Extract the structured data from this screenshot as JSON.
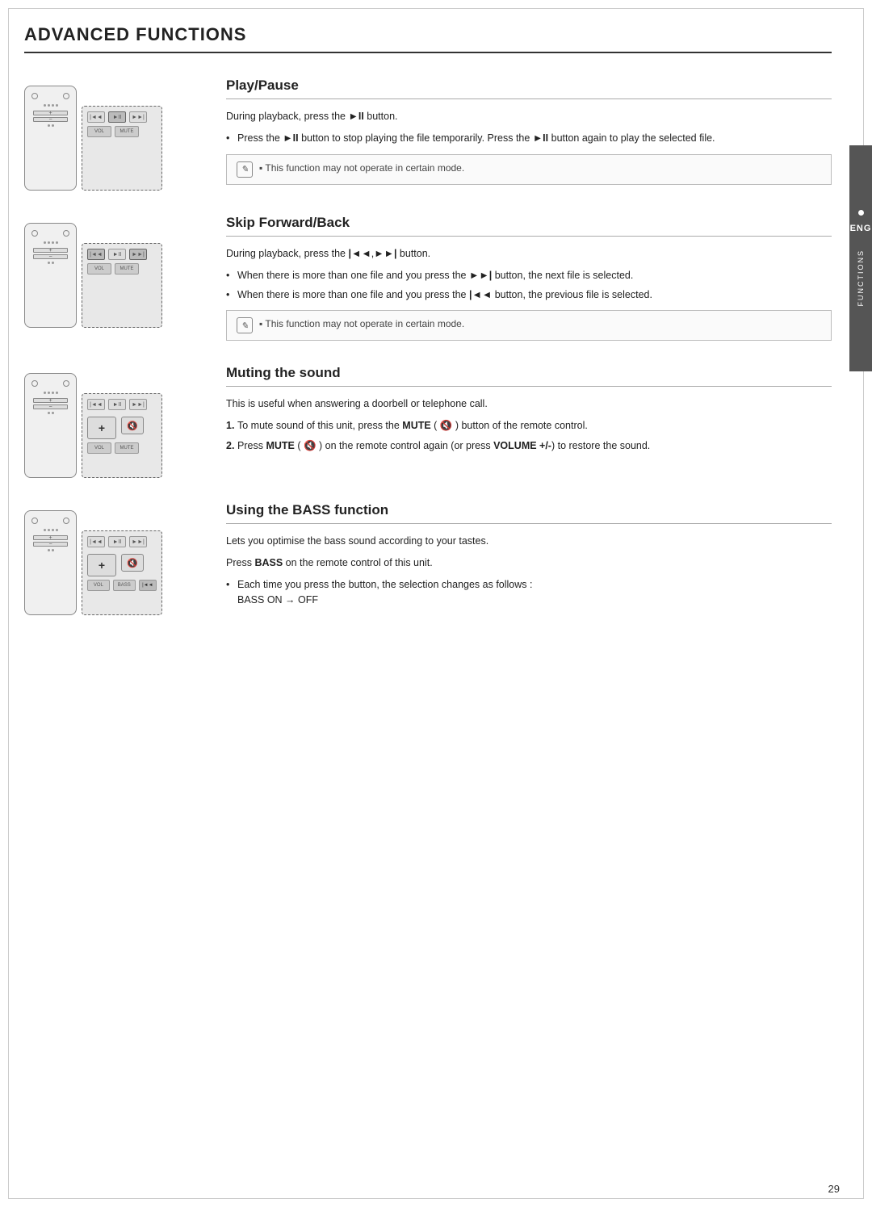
{
  "page": {
    "title": "ADVANCED FUNCTIONS",
    "page_number": "29",
    "side_tab": {
      "lang": "ENG",
      "label": "FUNCTIONS"
    }
  },
  "sections": [
    {
      "id": "play-pause",
      "heading": "Play/Pause",
      "description": "During playback, press the ►II button.",
      "bullets": [
        "Press the ►II button to stop playing the file temporarily. Press the ►II button again to play the selected file."
      ],
      "note": "This function may not operate in certain mode.",
      "ordered": [],
      "extra": []
    },
    {
      "id": "skip-forward-back",
      "heading": "Skip Forward/Back",
      "description": "During playback, press the |◄◄,►►| button.",
      "bullets": [
        "When there is more than one file and you press the ►►| button, the next file is selected.",
        "When there is more than one file and you press the |◄◄ button, the previous file is selected."
      ],
      "note": "This function may not operate in certain mode.",
      "ordered": [],
      "extra": []
    },
    {
      "id": "muting-sound",
      "heading": "Muting the sound",
      "description": "This is useful when answering a doorbell or telephone call.",
      "bullets": [],
      "note": "",
      "ordered": [
        "To mute sound of this unit, press the MUTE ( 🔇 ) button of the remote control.",
        "Press MUTE ( 🔇 ) on the remote control again (or press VOLUME +/-) to restore the sound."
      ],
      "extra": []
    },
    {
      "id": "bass-function",
      "heading": "Using the BASS function",
      "description": "Lets you optimise the bass sound according to your tastes.",
      "bullets": [
        "Each time you press the button, the selection changes as follows :\nBASS ON → OFF"
      ],
      "note": "",
      "ordered": [],
      "extra": [
        "Press BASS on the remote control of this unit."
      ]
    }
  ]
}
